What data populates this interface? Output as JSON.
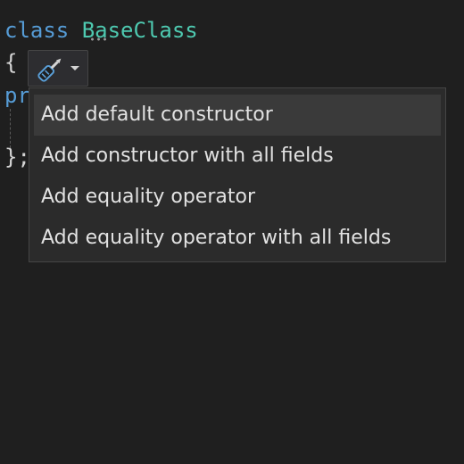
{
  "code": {
    "line1": {
      "keyword": "class",
      "class_name": "BaseClass"
    },
    "line2": {
      "brace": "{"
    },
    "line3": {
      "partial": "pr"
    },
    "line4": {
      "close": "};"
    }
  },
  "quick_actions": {
    "icon": "screwdriver-icon",
    "dropdown_icon": "chevron-down-icon",
    "items": [
      {
        "label": "Add default constructor",
        "selected": true
      },
      {
        "label": "Add constructor with all fields",
        "selected": false
      },
      {
        "label": "Add equality operator",
        "selected": false
      },
      {
        "label": "Add equality operator with all fields",
        "selected": false
      }
    ]
  },
  "colors": {
    "background": "#1f1f1f",
    "keyword": "#569cd6",
    "type": "#4ec9b0",
    "menu_background": "#2b2b2b",
    "menu_selected": "#3a3a3a",
    "menu_border": "#454545"
  }
}
